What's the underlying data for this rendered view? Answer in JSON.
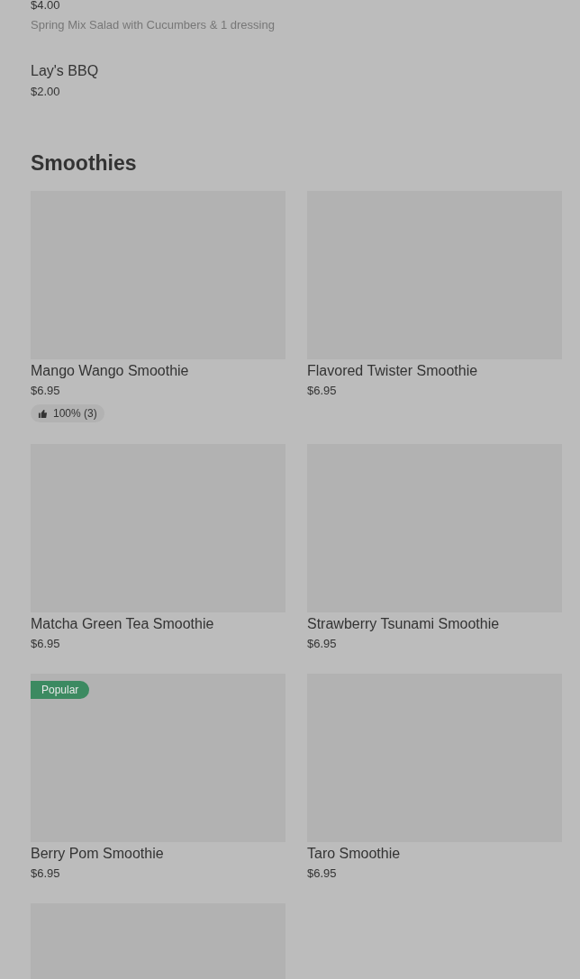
{
  "items": [
    {
      "price": "$4.00",
      "description": "Spring Mix Salad with Cucumbers & 1 dressing"
    },
    {
      "name": "Lay's BBQ",
      "price": "$2.00"
    }
  ],
  "section": {
    "title": "Smoothies",
    "cards": [
      {
        "kind": "product",
        "name": "Mango Wango Smoothie",
        "price": "$6.95",
        "rating": "100% (3)"
      },
      {
        "kind": "product",
        "name": "Flavored Twister Smoothie",
        "price": "$6.95"
      },
      {
        "kind": "product",
        "name": "Matcha Green Tea Smoothie",
        "price": "$6.95"
      },
      {
        "kind": "product",
        "name": "Strawberry Tsunami Smoothie",
        "price": "$6.95"
      },
      {
        "kind": "product",
        "name": "Berry Pom Smoothie",
        "price": "$6.95",
        "badge": "Popular"
      },
      {
        "kind": "product",
        "name": "Taro Smoothie",
        "price": "$6.95"
      },
      {
        "kind": "picture"
      }
    ]
  }
}
